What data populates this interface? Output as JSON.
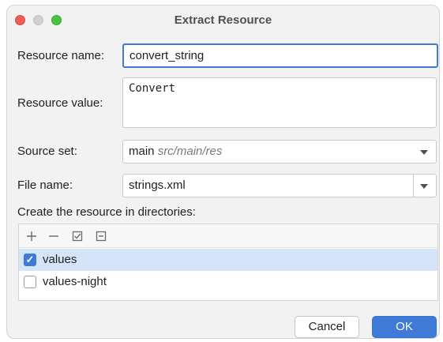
{
  "window": {
    "title": "Extract Resource"
  },
  "form": {
    "resource_name_label": "Resource name:",
    "resource_name_value": "convert_string",
    "resource_value_label": "Resource value:",
    "resource_value_value": "Convert",
    "source_set_label": "Source set:",
    "source_set_value": "main",
    "source_set_path": "src/main/res",
    "file_name_label": "File name:",
    "file_name_value": "strings.xml",
    "directories_label": "Create the resource in directories:"
  },
  "toolbar_icons": [
    "add-icon",
    "remove-icon",
    "select-all-icon",
    "unselect-all-icon"
  ],
  "directories": [
    {
      "label": "values",
      "checked": true,
      "selected": true
    },
    {
      "label": "values-night",
      "checked": false,
      "selected": false
    }
  ],
  "buttons": {
    "cancel": "Cancel",
    "ok": "OK"
  },
  "colors": {
    "accent": "#3f7ad8",
    "selection": "#d6e4fa"
  }
}
